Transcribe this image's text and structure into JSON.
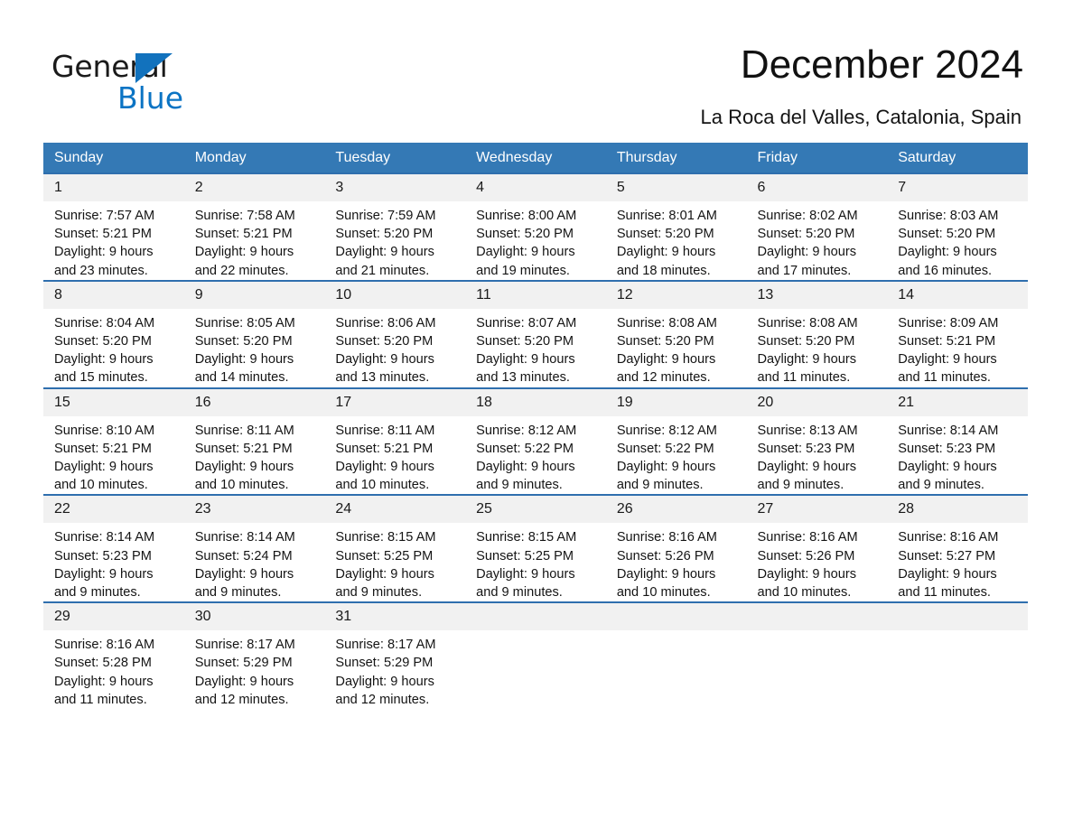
{
  "brand": {
    "name_part1": "General",
    "name_part2": "Blue",
    "accent_color": "#1272bd",
    "blue_text_color": "#0b74c4"
  },
  "header": {
    "title": "December 2024",
    "subtitle": "La Roca del Valles, Catalonia, Spain"
  },
  "calendar": {
    "header_bg": "#3479b5",
    "daynum_bg": "#f1f1f1",
    "row_border": "#2f6fae",
    "weekday_headers": [
      "Sunday",
      "Monday",
      "Tuesday",
      "Wednesday",
      "Thursday",
      "Friday",
      "Saturday"
    ],
    "weeks": [
      [
        {
          "day": "1",
          "sunrise": "Sunrise: 7:57 AM",
          "sunset": "Sunset: 5:21 PM",
          "daylight_line1": "Daylight: 9 hours",
          "daylight_line2": "and 23 minutes."
        },
        {
          "day": "2",
          "sunrise": "Sunrise: 7:58 AM",
          "sunset": "Sunset: 5:21 PM",
          "daylight_line1": "Daylight: 9 hours",
          "daylight_line2": "and 22 minutes."
        },
        {
          "day": "3",
          "sunrise": "Sunrise: 7:59 AM",
          "sunset": "Sunset: 5:20 PM",
          "daylight_line1": "Daylight: 9 hours",
          "daylight_line2": "and 21 minutes."
        },
        {
          "day": "4",
          "sunrise": "Sunrise: 8:00 AM",
          "sunset": "Sunset: 5:20 PM",
          "daylight_line1": "Daylight: 9 hours",
          "daylight_line2": "and 19 minutes."
        },
        {
          "day": "5",
          "sunrise": "Sunrise: 8:01 AM",
          "sunset": "Sunset: 5:20 PM",
          "daylight_line1": "Daylight: 9 hours",
          "daylight_line2": "and 18 minutes."
        },
        {
          "day": "6",
          "sunrise": "Sunrise: 8:02 AM",
          "sunset": "Sunset: 5:20 PM",
          "daylight_line1": "Daylight: 9 hours",
          "daylight_line2": "and 17 minutes."
        },
        {
          "day": "7",
          "sunrise": "Sunrise: 8:03 AM",
          "sunset": "Sunset: 5:20 PM",
          "daylight_line1": "Daylight: 9 hours",
          "daylight_line2": "and 16 minutes."
        }
      ],
      [
        {
          "day": "8",
          "sunrise": "Sunrise: 8:04 AM",
          "sunset": "Sunset: 5:20 PM",
          "daylight_line1": "Daylight: 9 hours",
          "daylight_line2": "and 15 minutes."
        },
        {
          "day": "9",
          "sunrise": "Sunrise: 8:05 AM",
          "sunset": "Sunset: 5:20 PM",
          "daylight_line1": "Daylight: 9 hours",
          "daylight_line2": "and 14 minutes."
        },
        {
          "day": "10",
          "sunrise": "Sunrise: 8:06 AM",
          "sunset": "Sunset: 5:20 PM",
          "daylight_line1": "Daylight: 9 hours",
          "daylight_line2": "and 13 minutes."
        },
        {
          "day": "11",
          "sunrise": "Sunrise: 8:07 AM",
          "sunset": "Sunset: 5:20 PM",
          "daylight_line1": "Daylight: 9 hours",
          "daylight_line2": "and 13 minutes."
        },
        {
          "day": "12",
          "sunrise": "Sunrise: 8:08 AM",
          "sunset": "Sunset: 5:20 PM",
          "daylight_line1": "Daylight: 9 hours",
          "daylight_line2": "and 12 minutes."
        },
        {
          "day": "13",
          "sunrise": "Sunrise: 8:08 AM",
          "sunset": "Sunset: 5:20 PM",
          "daylight_line1": "Daylight: 9 hours",
          "daylight_line2": "and 11 minutes."
        },
        {
          "day": "14",
          "sunrise": "Sunrise: 8:09 AM",
          "sunset": "Sunset: 5:21 PM",
          "daylight_line1": "Daylight: 9 hours",
          "daylight_line2": "and 11 minutes."
        }
      ],
      [
        {
          "day": "15",
          "sunrise": "Sunrise: 8:10 AM",
          "sunset": "Sunset: 5:21 PM",
          "daylight_line1": "Daylight: 9 hours",
          "daylight_line2": "and 10 minutes."
        },
        {
          "day": "16",
          "sunrise": "Sunrise: 8:11 AM",
          "sunset": "Sunset: 5:21 PM",
          "daylight_line1": "Daylight: 9 hours",
          "daylight_line2": "and 10 minutes."
        },
        {
          "day": "17",
          "sunrise": "Sunrise: 8:11 AM",
          "sunset": "Sunset: 5:21 PM",
          "daylight_line1": "Daylight: 9 hours",
          "daylight_line2": "and 10 minutes."
        },
        {
          "day": "18",
          "sunrise": "Sunrise: 8:12 AM",
          "sunset": "Sunset: 5:22 PM",
          "daylight_line1": "Daylight: 9 hours",
          "daylight_line2": "and 9 minutes."
        },
        {
          "day": "19",
          "sunrise": "Sunrise: 8:12 AM",
          "sunset": "Sunset: 5:22 PM",
          "daylight_line1": "Daylight: 9 hours",
          "daylight_line2": "and 9 minutes."
        },
        {
          "day": "20",
          "sunrise": "Sunrise: 8:13 AM",
          "sunset": "Sunset: 5:23 PM",
          "daylight_line1": "Daylight: 9 hours",
          "daylight_line2": "and 9 minutes."
        },
        {
          "day": "21",
          "sunrise": "Sunrise: 8:14 AM",
          "sunset": "Sunset: 5:23 PM",
          "daylight_line1": "Daylight: 9 hours",
          "daylight_line2": "and 9 minutes."
        }
      ],
      [
        {
          "day": "22",
          "sunrise": "Sunrise: 8:14 AM",
          "sunset": "Sunset: 5:23 PM",
          "daylight_line1": "Daylight: 9 hours",
          "daylight_line2": "and 9 minutes."
        },
        {
          "day": "23",
          "sunrise": "Sunrise: 8:14 AM",
          "sunset": "Sunset: 5:24 PM",
          "daylight_line1": "Daylight: 9 hours",
          "daylight_line2": "and 9 minutes."
        },
        {
          "day": "24",
          "sunrise": "Sunrise: 8:15 AM",
          "sunset": "Sunset: 5:25 PM",
          "daylight_line1": "Daylight: 9 hours",
          "daylight_line2": "and 9 minutes."
        },
        {
          "day": "25",
          "sunrise": "Sunrise: 8:15 AM",
          "sunset": "Sunset: 5:25 PM",
          "daylight_line1": "Daylight: 9 hours",
          "daylight_line2": "and 9 minutes."
        },
        {
          "day": "26",
          "sunrise": "Sunrise: 8:16 AM",
          "sunset": "Sunset: 5:26 PM",
          "daylight_line1": "Daylight: 9 hours",
          "daylight_line2": "and 10 minutes."
        },
        {
          "day": "27",
          "sunrise": "Sunrise: 8:16 AM",
          "sunset": "Sunset: 5:26 PM",
          "daylight_line1": "Daylight: 9 hours",
          "daylight_line2": "and 10 minutes."
        },
        {
          "day": "28",
          "sunrise": "Sunrise: 8:16 AM",
          "sunset": "Sunset: 5:27 PM",
          "daylight_line1": "Daylight: 9 hours",
          "daylight_line2": "and 11 minutes."
        }
      ],
      [
        {
          "day": "29",
          "sunrise": "Sunrise: 8:16 AM",
          "sunset": "Sunset: 5:28 PM",
          "daylight_line1": "Daylight: 9 hours",
          "daylight_line2": "and 11 minutes."
        },
        {
          "day": "30",
          "sunrise": "Sunrise: 8:17 AM",
          "sunset": "Sunset: 5:29 PM",
          "daylight_line1": "Daylight: 9 hours",
          "daylight_line2": "and 12 minutes."
        },
        {
          "day": "31",
          "sunrise": "Sunrise: 8:17 AM",
          "sunset": "Sunset: 5:29 PM",
          "daylight_line1": "Daylight: 9 hours",
          "daylight_line2": "and 12 minutes."
        },
        {
          "day": "",
          "sunrise": "",
          "sunset": "",
          "daylight_line1": "",
          "daylight_line2": ""
        },
        {
          "day": "",
          "sunrise": "",
          "sunset": "",
          "daylight_line1": "",
          "daylight_line2": ""
        },
        {
          "day": "",
          "sunrise": "",
          "sunset": "",
          "daylight_line1": "",
          "daylight_line2": ""
        },
        {
          "day": "",
          "sunrise": "",
          "sunset": "",
          "daylight_line1": "",
          "daylight_line2": ""
        }
      ]
    ]
  }
}
